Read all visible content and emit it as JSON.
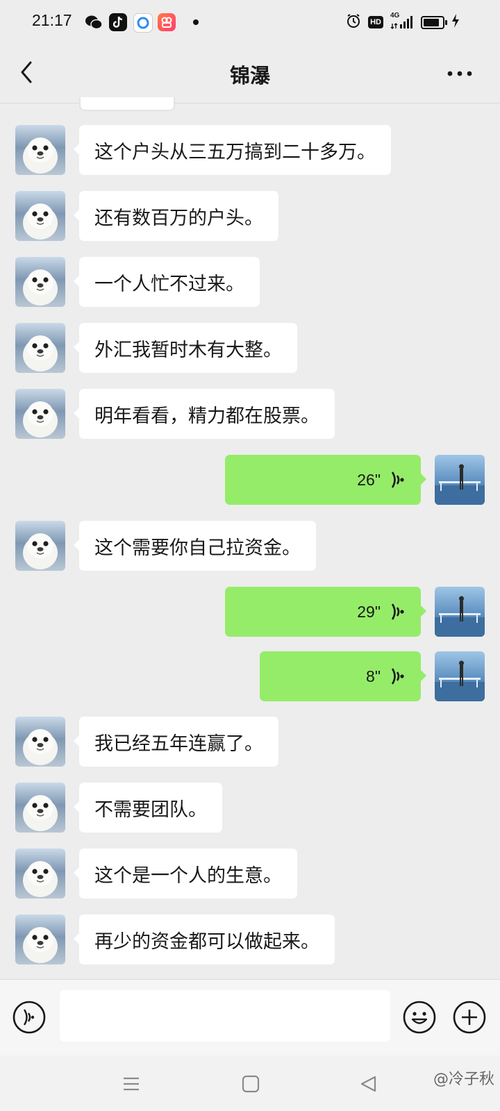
{
  "status_bar": {
    "time": "21:17",
    "network": "4G",
    "hd_badge": "HD",
    "app_icons": [
      "wechat-icon",
      "douyin-icon",
      "browser-icon",
      "kuaishou-icon"
    ]
  },
  "header": {
    "title": "锦瀑",
    "back_icon": "chevron-left-icon",
    "more_icon": "more-dots-icon"
  },
  "messages": [
    {
      "side": "left",
      "type": "text",
      "text": "这个户头从三五万搞到二十多万。"
    },
    {
      "side": "left",
      "type": "text",
      "text": "还有数百万的户头。"
    },
    {
      "side": "left",
      "type": "text",
      "text": "一个人忙不过来。"
    },
    {
      "side": "left",
      "type": "text",
      "text": "外汇我暂时木有大整。"
    },
    {
      "side": "left",
      "type": "text",
      "text": "明年看看，精力都在股票。"
    },
    {
      "side": "right",
      "type": "voice",
      "duration": "26\""
    },
    {
      "side": "left",
      "type": "text",
      "text": "这个需要你自己拉资金。"
    },
    {
      "side": "right",
      "type": "voice",
      "duration": "29\""
    },
    {
      "side": "right",
      "type": "voice",
      "duration": "8\""
    },
    {
      "side": "left",
      "type": "text",
      "text": "我已经五年连赢了。"
    },
    {
      "side": "left",
      "type": "text",
      "text": "不需要团队。"
    },
    {
      "side": "left",
      "type": "text",
      "text": "这个是一个人的生意。"
    },
    {
      "side": "left",
      "type": "text",
      "text": "再少的资金都可以做起来。"
    }
  ],
  "input_bar": {
    "voice_icon": "voice-mode-icon",
    "placeholder": "",
    "emoji_icon": "emoji-icon",
    "plus_icon": "plus-icon"
  },
  "nav_bar": {
    "icons": [
      "menu-icon",
      "home-icon",
      "back-triangle-icon"
    ]
  },
  "watermark": "@冷子秋",
  "colors": {
    "background": "#EDEDED",
    "incoming_bubble": "#FFFFFF",
    "outgoing_bubble": "#95EC69",
    "text": "#191919"
  }
}
